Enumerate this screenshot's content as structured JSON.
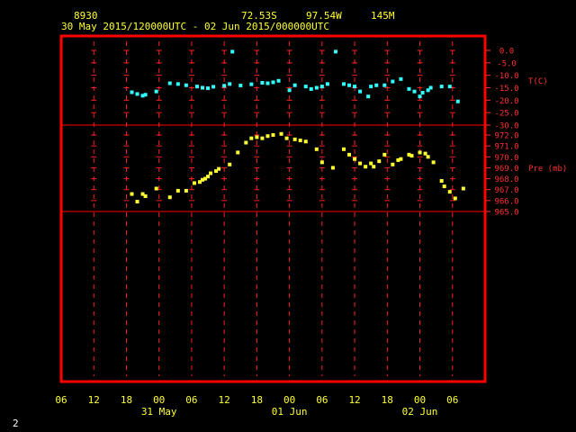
{
  "header": {
    "station_id": "8930",
    "latitude": "72.53S",
    "longitude": "97.54W",
    "elevation": "145M",
    "time_range": "30 May 2015/120000UTC - 02 Jun 2015/000000UTC"
  },
  "corner_label": "2",
  "colors": {
    "frame": "#ff0000",
    "grid": "#ff2020",
    "axis_text": "#ffff33",
    "right_text": "#ff3030",
    "temperature": "#33ffff",
    "pressure": "#ffff33"
  },
  "chart_data": [
    {
      "type": "scatter",
      "title": "",
      "ylabel": "T(C)",
      "ylim": [
        -30,
        0
      ],
      "yticks": [
        0,
        -5,
        -10,
        -15,
        -20,
        -25,
        -30
      ],
      "ytick_labels": [
        "0.0",
        "-5.0",
        "-10.0",
        "-15.0",
        "-20.0",
        "-25.0",
        "-30.0"
      ],
      "x_unit": "hours since 30 May 06 UTC",
      "series": [
        {
          "points": [
            [
              13.0,
              -16.8
            ],
            [
              14.0,
              -17.5
            ],
            [
              15.0,
              -18.2
            ],
            [
              15.5,
              -17.8
            ],
            [
              17.5,
              -16.5
            ],
            [
              20.0,
              -13.2
            ],
            [
              21.5,
              -13.5
            ],
            [
              23.0,
              -14.0
            ],
            [
              25.0,
              -14.5
            ],
            [
              26.0,
              -15.0
            ],
            [
              27.0,
              -15.2
            ],
            [
              28.0,
              -14.6
            ],
            [
              30.0,
              -14.2
            ],
            [
              31.0,
              -13.5
            ],
            [
              31.5,
              -0.5
            ],
            [
              33.0,
              -14.1
            ],
            [
              35.0,
              -13.6
            ],
            [
              37.0,
              -13.0
            ],
            [
              38.0,
              -13.2
            ],
            [
              39.0,
              -12.8
            ],
            [
              40.0,
              -12.2
            ],
            [
              42.0,
              -16.0
            ],
            [
              43.0,
              -14.0
            ],
            [
              45.0,
              -14.5
            ],
            [
              46.0,
              -15.5
            ],
            [
              47.0,
              -15.0
            ],
            [
              48.0,
              -14.5
            ],
            [
              49.0,
              -13.5
            ],
            [
              50.5,
              -0.5
            ],
            [
              52.0,
              -13.5
            ],
            [
              53.0,
              -14.0
            ],
            [
              54.0,
              -14.5
            ],
            [
              55.0,
              -16.5
            ],
            [
              56.5,
              -18.5
            ],
            [
              57.0,
              -14.5
            ],
            [
              58.0,
              -14.0
            ],
            [
              59.5,
              -14.0
            ],
            [
              61.0,
              -12.5
            ],
            [
              62.5,
              -11.5
            ],
            [
              64.0,
              -15.5
            ],
            [
              65.0,
              -16.5
            ],
            [
              66.0,
              -18.5
            ],
            [
              66.5,
              -17.0
            ],
            [
              67.5,
              -16.0
            ],
            [
              68.0,
              -15.0
            ],
            [
              70.0,
              -14.5
            ],
            [
              71.5,
              -14.5
            ],
            [
              73.0,
              -20.5
            ]
          ]
        }
      ]
    },
    {
      "type": "scatter",
      "title": "",
      "ylabel": "Pre (mb)",
      "ylim": [
        965,
        972
      ],
      "yticks": [
        972,
        971,
        970,
        969,
        968,
        967,
        966,
        965
      ],
      "ytick_labels": [
        "972.0",
        "971.0",
        "970.0",
        "969.0",
        "968.0",
        "967.0",
        "966.0",
        "965.0"
      ],
      "x_unit": "hours since 30 May 06 UTC",
      "series": [
        {
          "points": [
            [
              13.0,
              966.6
            ],
            [
              14.0,
              965.9
            ],
            [
              15.0,
              966.6
            ],
            [
              15.5,
              966.4
            ],
            [
              17.5,
              967.1
            ],
            [
              20.0,
              966.3
            ],
            [
              21.5,
              966.9
            ],
            [
              23.0,
              966.9
            ],
            [
              24.5,
              967.6
            ],
            [
              25.5,
              967.7
            ],
            [
              26.0,
              967.9
            ],
            [
              26.5,
              968.0
            ],
            [
              27.0,
              968.2
            ],
            [
              27.5,
              968.5
            ],
            [
              28.5,
              968.7
            ],
            [
              29.0,
              968.9
            ],
            [
              31.0,
              969.3
            ],
            [
              32.5,
              970.4
            ],
            [
              34.0,
              971.3
            ],
            [
              35.0,
              971.7
            ],
            [
              36.0,
              971.8
            ],
            [
              37.0,
              971.7
            ],
            [
              38.0,
              971.9
            ],
            [
              39.0,
              972.0
            ],
            [
              40.5,
              972.1
            ],
            [
              41.5,
              971.7
            ],
            [
              43.0,
              971.6
            ],
            [
              44.0,
              971.5
            ],
            [
              45.0,
              971.4
            ],
            [
              47.0,
              970.7
            ],
            [
              48.0,
              969.5
            ],
            [
              50.0,
              969.0
            ],
            [
              52.0,
              970.7
            ],
            [
              53.0,
              970.2
            ],
            [
              54.0,
              969.8
            ],
            [
              55.0,
              969.4
            ],
            [
              56.0,
              969.1
            ],
            [
              57.0,
              969.4
            ],
            [
              57.5,
              969.1
            ],
            [
              58.5,
              969.6
            ],
            [
              59.5,
              970.2
            ],
            [
              61.0,
              969.3
            ],
            [
              62.0,
              969.7
            ],
            [
              62.5,
              969.8
            ],
            [
              64.0,
              970.2
            ],
            [
              64.5,
              970.1
            ],
            [
              66.0,
              970.4
            ],
            [
              67.0,
              970.3
            ],
            [
              67.5,
              970.0
            ],
            [
              68.5,
              969.5
            ],
            [
              70.0,
              967.8
            ],
            [
              70.5,
              967.3
            ],
            [
              71.5,
              966.8
            ],
            [
              72.5,
              966.2
            ],
            [
              74.0,
              967.1
            ]
          ]
        }
      ]
    }
  ],
  "x_axis": {
    "tick_labels": [
      "06",
      "12",
      "18",
      "00",
      "06",
      "12",
      "18",
      "00",
      "06",
      "12",
      "18",
      "00",
      "06"
    ],
    "date_labels": [
      "31 May",
      "01 Jun",
      "02 Jun"
    ]
  }
}
